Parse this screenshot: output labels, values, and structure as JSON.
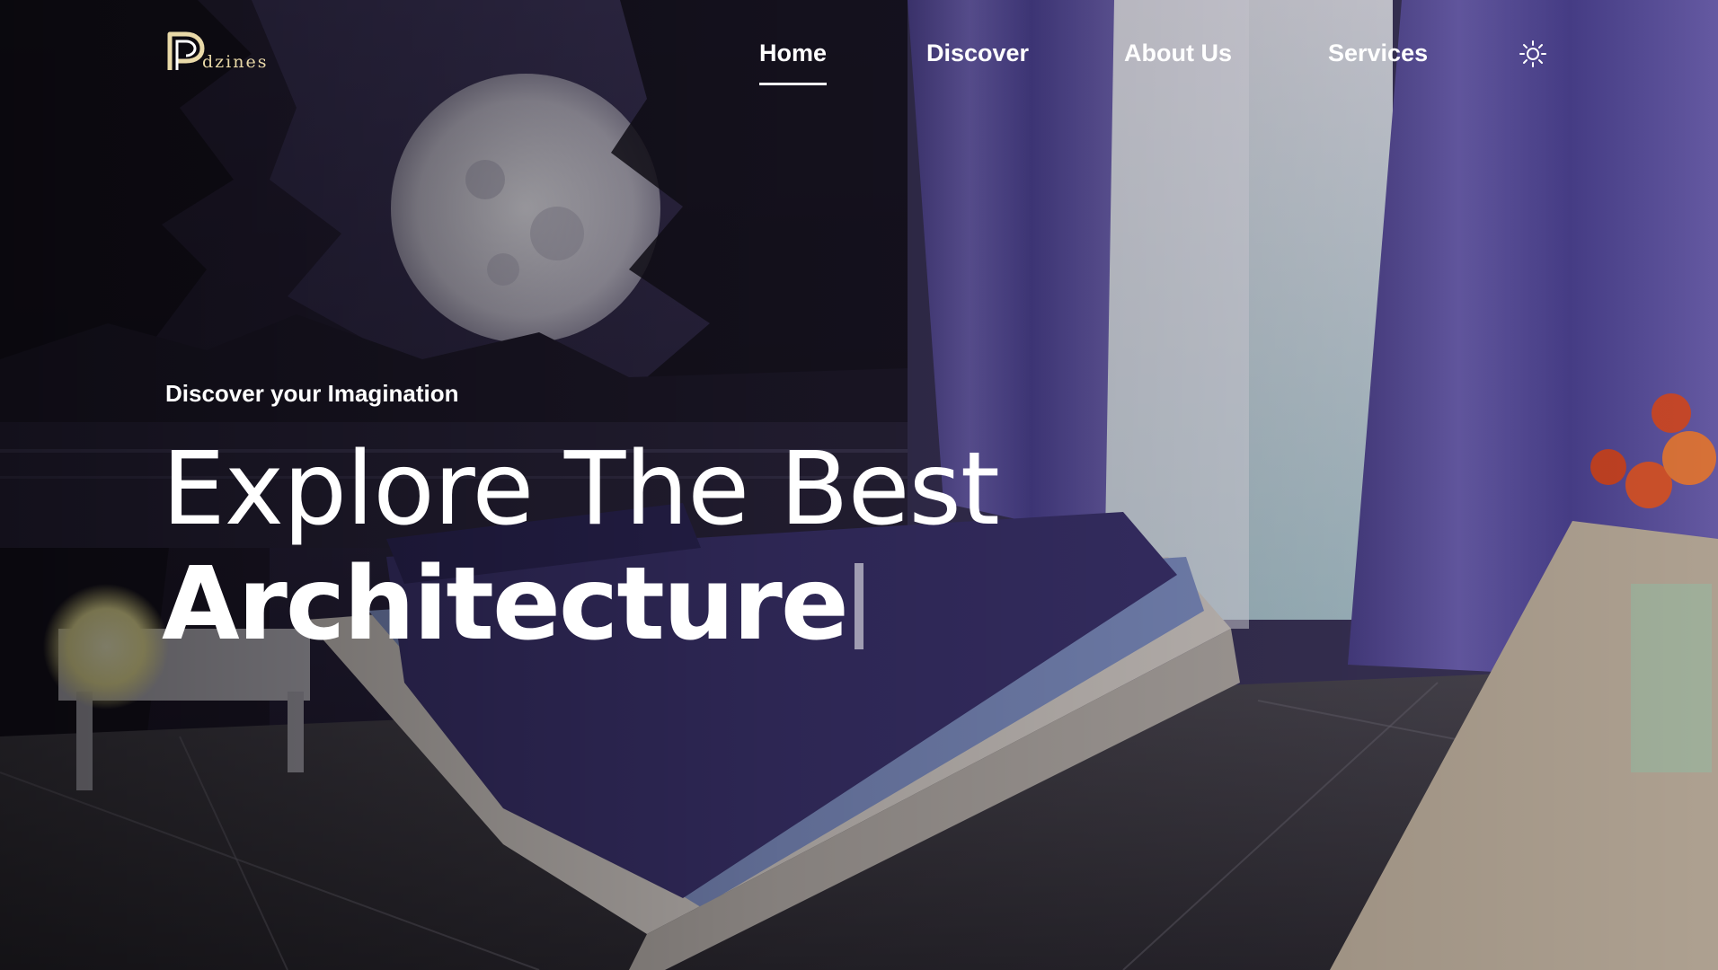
{
  "brand": {
    "logo_letter": "P",
    "logo_text": "dzines",
    "accent": "#e9d9a8"
  },
  "nav": {
    "items": [
      {
        "label": "Home",
        "active": true
      },
      {
        "label": "Discover",
        "active": false
      },
      {
        "label": "About Us",
        "active": false
      },
      {
        "label": "Services",
        "active": false
      }
    ],
    "theme_toggle_icon": "sun-icon"
  },
  "hero": {
    "eyebrow": "Discover your Imagination",
    "headline_line1": "Explore The Best",
    "headline_line2": "Architecture",
    "background": "night-moon-bedroom-scene"
  },
  "colors": {
    "nav_text": "#ffffff",
    "headline": "#ffffff",
    "wall": "#3a3358",
    "curtain": "#5a4d9a"
  }
}
